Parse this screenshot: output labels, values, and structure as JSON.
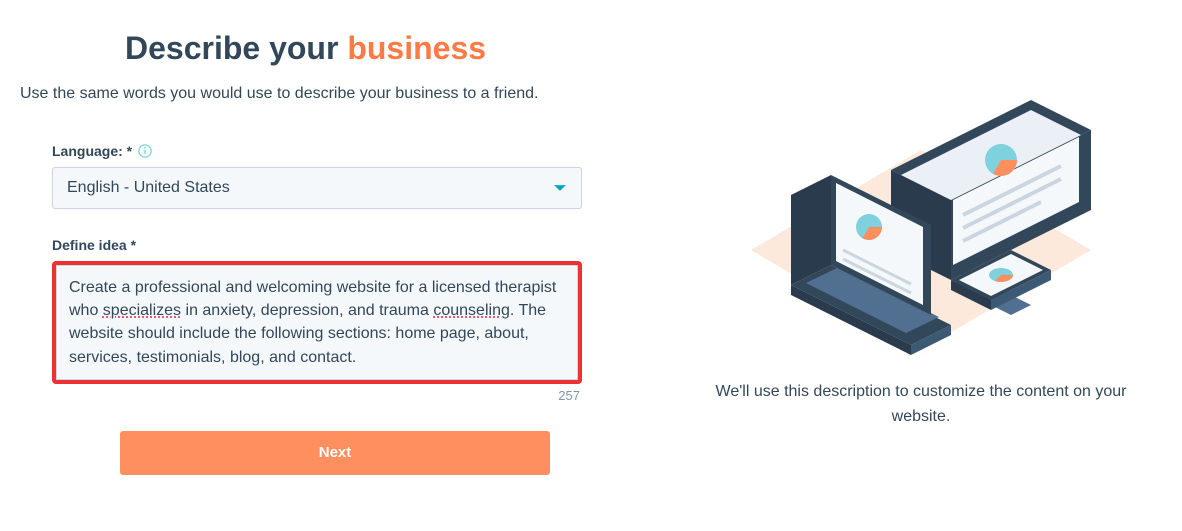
{
  "heading_part1": "Describe your ",
  "heading_accent": "business",
  "subtitle": "Use the same words you would use to describe your business to a friend.",
  "language": {
    "label": "Language: *",
    "value": "English - United States"
  },
  "idea": {
    "label": "Define idea *",
    "value_plain": "Create a professional and welcoming website for a licensed therapist who specializes in anxiety, depression, and trauma counseling. The website should include the following sections: home page, about, services, testimonials, blog, and contact.",
    "char_count": "257"
  },
  "next_label": "Next",
  "right_caption": "We'll use this description to customize the content on your website."
}
